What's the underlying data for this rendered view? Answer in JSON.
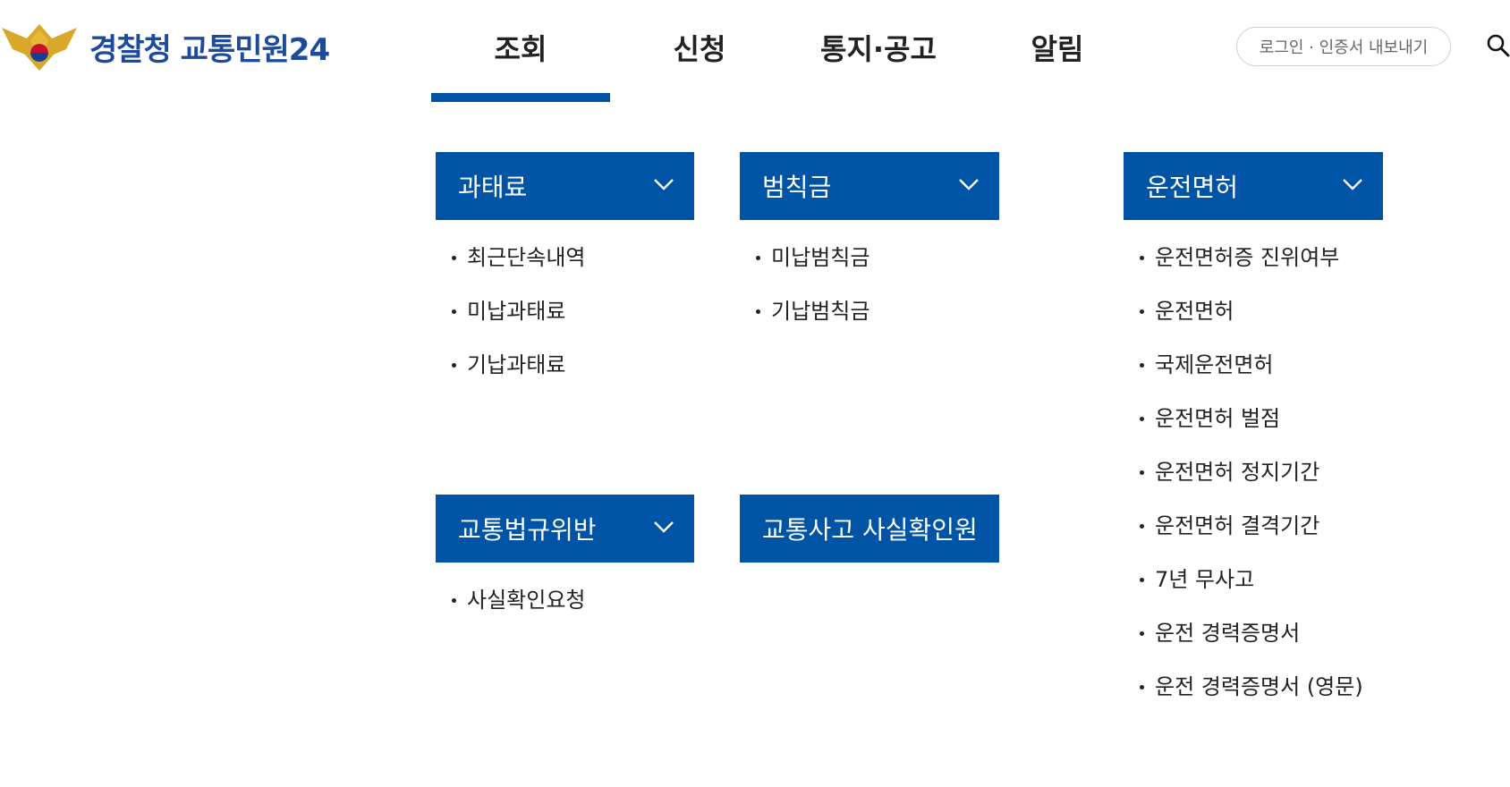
{
  "brand": {
    "name": "경찰청 교통민원24"
  },
  "nav": {
    "items": [
      {
        "label": "조회"
      },
      {
        "label": "신청"
      },
      {
        "label": "통지·공고"
      },
      {
        "label": "알림"
      }
    ],
    "active_index": 0
  },
  "header": {
    "login_label": "로그인 · 인증서 내보내기",
    "search_icon": "search-icon"
  },
  "colors": {
    "accent": "#0054a6",
    "brand_text": "#1e4a9a"
  },
  "menus": [
    {
      "title": "과태료",
      "expandable": true,
      "items": [
        "최근단속내역",
        "미납과태료",
        "기납과태료"
      ]
    },
    {
      "title": "범칙금",
      "expandable": true,
      "items": [
        "미납범칙금",
        "기납범칙금"
      ]
    },
    {
      "title": "운전면허",
      "expandable": true,
      "items": [
        "운전면허증 진위여부",
        "운전면허",
        "국제운전면허",
        "운전면허 벌점",
        "운전면허 정지기간",
        "운전면허 결격기간",
        "7년 무사고",
        "운전 경력증명서",
        "운전 경력증명서 (영문)"
      ]
    },
    {
      "title": "교통법규위반",
      "expandable": true,
      "items": [
        "사실확인요청"
      ]
    },
    {
      "title": "교통사고 사실확인원",
      "expandable": false,
      "items": []
    }
  ]
}
